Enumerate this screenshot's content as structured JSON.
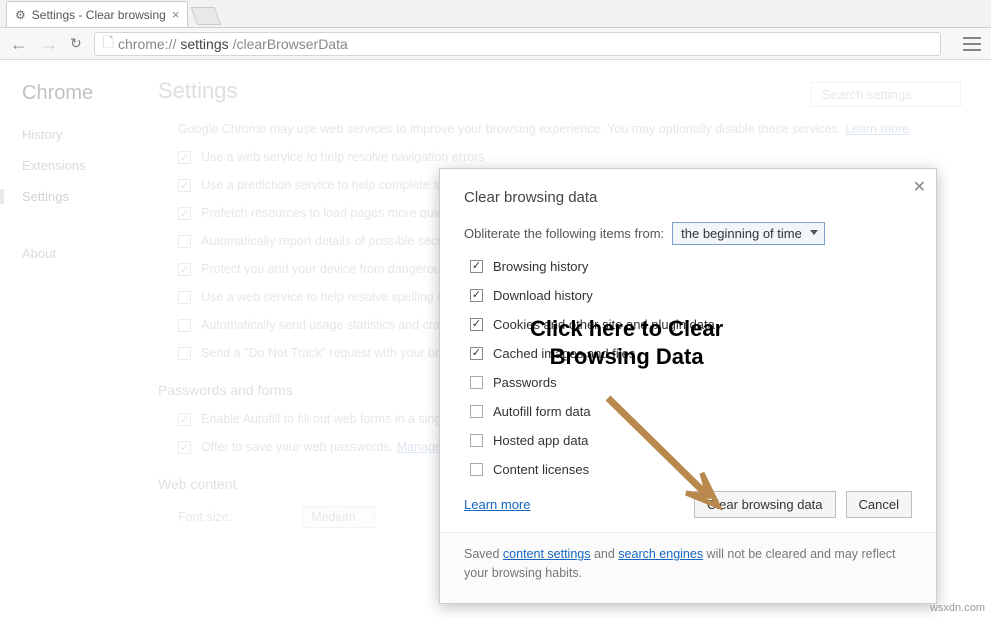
{
  "tab": {
    "title": "Settings - Clear browsing"
  },
  "url": {
    "prefix": "chrome://",
    "mid": "settings",
    "rest": "/clearBrowserData"
  },
  "sidebar": {
    "brand": "Chrome",
    "history": "History",
    "extensions": "Extensions",
    "settings": "Settings",
    "about": "About"
  },
  "page": {
    "title": "Settings",
    "search_placeholder": "Search settings",
    "intro_a": "Google Chrome may use web services to improve your browsing experience. You may optionally disable these services. ",
    "intro_link": "Learn more",
    "opts": [
      {
        "c": true,
        "t": "Use a web service to help resolve navigation errors"
      },
      {
        "c": true,
        "t": "Use a prediction service to help complete searches and URLs typed in the address bar or the app launcher search box"
      },
      {
        "c": true,
        "t": "Prefetch resources to load pages more quickly"
      },
      {
        "c": false,
        "t": "Automatically report details of possible security incidents to Google"
      },
      {
        "c": true,
        "t": "Protect you and your device from dangerous sites"
      },
      {
        "c": false,
        "t": "Use a web service to help resolve spelling errors"
      },
      {
        "c": false,
        "t": "Automatically send usage statistics and crash reports to Google"
      },
      {
        "c": false,
        "t": "Send a \"Do Not Track\" request with your browsing traffic"
      }
    ],
    "pw_h": "Passwords and forms",
    "pw1": "Enable Autofill to fill out web forms in a single click.",
    "pw2": "Offer to save your web passwords. ",
    "pw2_link": "Manage passwords",
    "wc_h": "Web content",
    "font_label": "Font size:",
    "font_value": "Medium"
  },
  "dialog": {
    "title": "Clear browsing data",
    "label": "Obliterate the following items from:",
    "range": "the beginning of time",
    "items": [
      {
        "c": true,
        "t": "Browsing history"
      },
      {
        "c": true,
        "t": "Download history"
      },
      {
        "c": true,
        "t": "Cookies and other site and plugin data"
      },
      {
        "c": true,
        "t": "Cached images and files"
      },
      {
        "c": false,
        "t": "Passwords"
      },
      {
        "c": false,
        "t": "Autofill form data"
      },
      {
        "c": false,
        "t": "Hosted app data"
      },
      {
        "c": false,
        "t": "Content licenses"
      }
    ],
    "learn": "Learn more",
    "primary": "Clear browsing data",
    "cancel": "Cancel",
    "foot_a": "Saved ",
    "foot_l1": "content settings",
    "foot_b": " and ",
    "foot_l2": "search engines",
    "foot_c": " will not be cleared and may reflect your browsing habits."
  },
  "annotation": {
    "line1": "Click here to Clear",
    "line2": "Browsing Data"
  },
  "watermark": "wsxdn.com"
}
